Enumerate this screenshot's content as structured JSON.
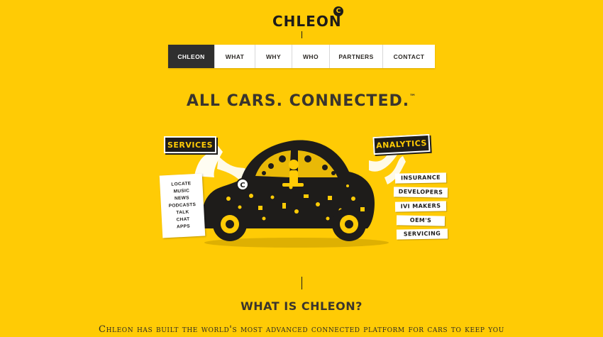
{
  "logo": {
    "text": "CHLEON",
    "badge": "C"
  },
  "nav": {
    "items": [
      {
        "label": "CHLEON"
      },
      {
        "label": "WHAT"
      },
      {
        "label": "WHY"
      },
      {
        "label": "WHO"
      },
      {
        "label": "PARTNERS"
      },
      {
        "label": "CONTACT"
      }
    ]
  },
  "hero": {
    "headline": "ALL CARS. CONNECTED.",
    "trademark": "™",
    "services_label": "SERVICES",
    "analytics_label": "ANALYTICS",
    "services_list": [
      "LOCATE",
      "MUSIC",
      "NEWS",
      "PODCASTS",
      "TALK",
      "CHAT",
      "APPS"
    ],
    "analytics_list": [
      "INSURANCE",
      "DEVELOPERS",
      "IVI MAKERS",
      "OEM'S",
      "SERVICING"
    ]
  },
  "section": {
    "title": "WHAT IS CHLEON?",
    "description": "Chleon has built the world's most advanced connected platform for cars to keep you"
  },
  "colors": {
    "background": "#ffcb05",
    "dark": "#1e1c1a",
    "nav_active": "#2f2f2f"
  }
}
